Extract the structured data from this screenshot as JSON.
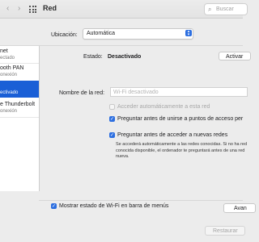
{
  "window": {
    "title": "Red",
    "back_icon": "chevron-left-icon",
    "forward_icon": "chevron-right-icon",
    "show_all_icon": "grid-icon",
    "search_placeholder": "Buscar",
    "search_icon": "search-icon"
  },
  "location": {
    "label": "Ubicación:",
    "value": "Automática"
  },
  "sidebar": {
    "items": [
      {
        "name": "net",
        "status": "ectado"
      },
      {
        "name": "ooth PAN",
        "status": "onexión"
      },
      {
        "name": "",
        "status": "ectivado"
      },
      {
        "name": "e Thunderbolt",
        "status": "onexión"
      }
    ],
    "selected_index": 2
  },
  "main": {
    "estado_label": "Estado:",
    "estado_value": "Desactivado",
    "activar_button": "Activar",
    "network_name_label": "Nombre de la red:",
    "network_name_placeholder": "Wi-Fi desactivado",
    "options": [
      {
        "label": "Acceder automáticamente a esta red",
        "checked": false,
        "disabled": true
      },
      {
        "label": "Preguntar antes de unirse a puntos de acceso per",
        "checked": true,
        "disabled": false
      },
      {
        "label": "Preguntar antes de acceder a nuevas redes",
        "checked": true,
        "disabled": false
      }
    ],
    "description": "Se accederá automáticamente a las redes conocidas. Si no ha red conocida disponible, el ordenador te preguntará antes de una red nueva.",
    "show_wifi_status_label": "Mostrar estado de Wi-Fi en barra de menús",
    "show_wifi_status_checked": true,
    "avanzado_button": "Avan",
    "restaurar_button": "Restaurar"
  },
  "colors": {
    "accent": "#2d6fe0",
    "selection": "#1a5fd6",
    "window_bg": "#ececec"
  }
}
